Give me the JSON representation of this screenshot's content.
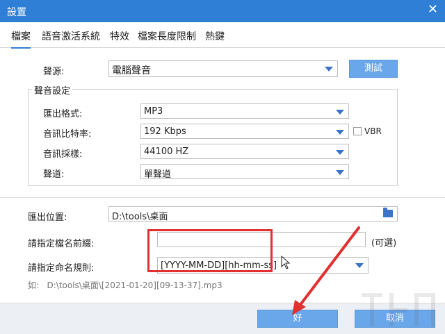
{
  "window": {
    "title": "設置",
    "close_glyph": "✕"
  },
  "tabs": [
    {
      "label": "檔案",
      "active": true
    },
    {
      "label": "語音激活系統",
      "active": false
    },
    {
      "label": "特效",
      "active": false
    },
    {
      "label": "檔案長度限制",
      "active": false
    },
    {
      "label": "熱鍵",
      "active": false
    }
  ],
  "audio_source": {
    "label": "聲源:",
    "value": "電腦聲音",
    "test_button": "測試"
  },
  "audio_settings": {
    "group_title": "聲音設定",
    "format": {
      "label": "匯出格式:",
      "value": "MP3"
    },
    "bitrate": {
      "label": "音訊比特率:",
      "value": "192 Kbps",
      "vbr_label": "VBR",
      "vbr_checked": false
    },
    "sample_rate": {
      "label": "音訊採樣:",
      "value": "44100 HZ"
    },
    "channel": {
      "label": "聲道:",
      "value": "單聲道"
    }
  },
  "output": {
    "location_label": "匯出位置:",
    "location_value": "D:\\tools\\桌面",
    "prefix_label": "請指定檔名前綴:",
    "prefix_value": "",
    "optional_label": "(可選)",
    "naming_label": "請指定命名規則:",
    "naming_value": "[YYYY-MM-DD][hh-mm-ss]",
    "example_label": "如:",
    "example_value": "D:\\tools\\桌面\\[2021-01-20][09-13-37].mp3"
  },
  "footer": {
    "ok_label": "好",
    "cancel_label": "取消"
  },
  "colors": {
    "titlebar": "#2f7fd6",
    "button": "#6aa7ea",
    "annotation": "#e0302f",
    "footer": "#eceff3"
  },
  "icons": {
    "folder": "folder-icon",
    "close": "close-icon",
    "dropdown": "chevron-down-icon"
  }
}
